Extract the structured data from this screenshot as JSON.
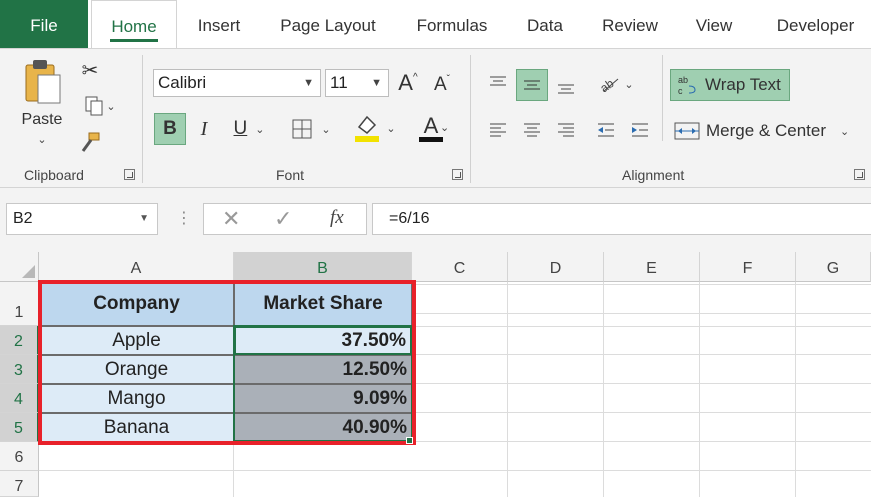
{
  "tabs": [
    "File",
    "Home",
    "Insert",
    "Page Layout",
    "Formulas",
    "Data",
    "Review",
    "View",
    "Developer"
  ],
  "active_tab": "Home",
  "ribbon": {
    "clipboard": {
      "paste_label": "Paste",
      "group_label": "Clipboard"
    },
    "font": {
      "font_name": "Calibri",
      "font_size": "11",
      "group_label": "Font",
      "bold": "B",
      "italic": "I",
      "underline": "U",
      "grow": "A",
      "shrink": "A",
      "font_color": "A"
    },
    "alignment": {
      "wrap_text": "Wrap Text",
      "merge_center": "Merge & Center",
      "group_label": "Alignment"
    }
  },
  "formula_bar": {
    "name_box": "B2",
    "fx": "fx",
    "formula": "=6/16"
  },
  "columns": [
    "A",
    "B",
    "C",
    "D",
    "E",
    "F",
    "G"
  ],
  "rows": [
    "1",
    "2",
    "3",
    "4",
    "5",
    "6",
    "7"
  ],
  "table": {
    "headers": [
      "Company",
      "Market Share"
    ],
    "rows": [
      {
        "company": "Apple",
        "share": "37.50%"
      },
      {
        "company": "Orange",
        "share": "12.50%"
      },
      {
        "company": "Mango",
        "share": "9.09%"
      },
      {
        "company": "Banana",
        "share": "40.90%"
      }
    ]
  },
  "colors": {
    "excel_green": "#217346",
    "header_fill": "#bdd7ee",
    "name_fill": "#ddebf7",
    "value_fill": "#aab0b8",
    "highlight": "#e8212a"
  }
}
